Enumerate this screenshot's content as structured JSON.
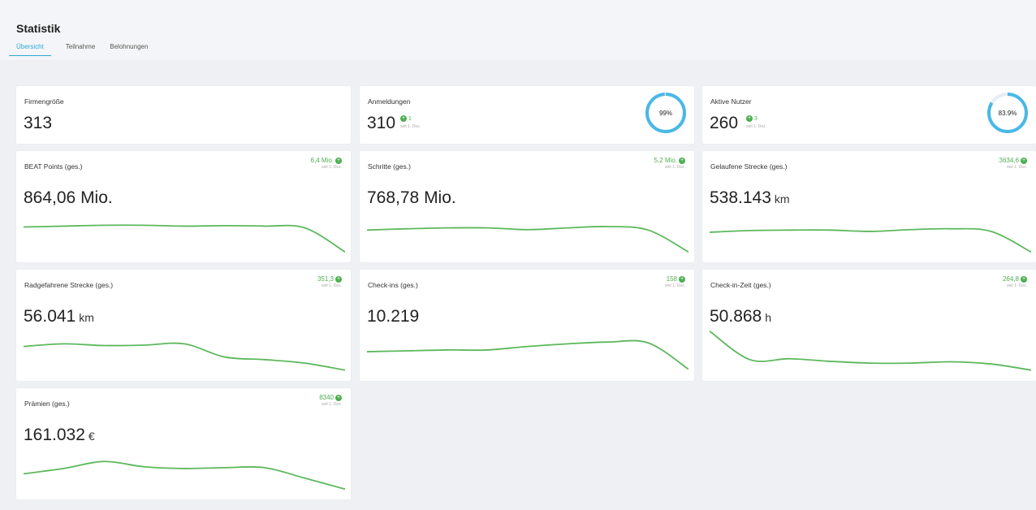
{
  "page": {
    "title": "Statistik",
    "tabs": [
      {
        "label": "Übersicht",
        "active": true
      },
      {
        "label": "Teilnahme",
        "active": false
      },
      {
        "label": "Belohnungen",
        "active": false
      }
    ]
  },
  "colors": {
    "accent": "#2aa8d8",
    "positive": "#4caf50",
    "sparkline": "#5cb85c",
    "ring": "#49b8e6"
  },
  "top_cards": {
    "firmengroesse": {
      "title": "Firmengröße",
      "value": "313"
    },
    "anmeldungen": {
      "title": "Anmeldungen",
      "value": "310",
      "delta": "1",
      "delta_since": "seit 1. Dez.",
      "ring_label": "99%",
      "ring_percent": 99
    },
    "aktive_nutzer": {
      "title": "Aktive Nutzer",
      "value": "260",
      "delta": "3",
      "delta_since": "seit 1. Dez.",
      "ring_label": "83.9%",
      "ring_percent": 83.9
    }
  },
  "metric_cards": [
    {
      "key": "beat",
      "title": "BEAT Points (ges.)",
      "value": "864,06 Mio.",
      "unit": "",
      "delta": "6,4 Mio.",
      "delta_since": "seit 1. Dez.",
      "trend": [
        0.62,
        0.64,
        0.66,
        0.66,
        0.64,
        0.65,
        0.64,
        0.6,
        0.05
      ]
    },
    {
      "key": "schritte",
      "title": "Schritte (ges.)",
      "value": "768,78 Mio.",
      "unit": "",
      "delta": "5,2 Mio.",
      "delta_since": "seit 1. Dez.",
      "trend": [
        0.55,
        0.58,
        0.6,
        0.6,
        0.56,
        0.6,
        0.63,
        0.55,
        0.05
      ]
    },
    {
      "key": "strecke",
      "title": "Gelaufene Strecke (ges.)",
      "value": "538.143",
      "unit": "km",
      "delta": "3634,6",
      "delta_since": "seit 1. Dez.",
      "trend": [
        0.5,
        0.54,
        0.55,
        0.55,
        0.52,
        0.56,
        0.58,
        0.52,
        0.05
      ]
    },
    {
      "key": "rad",
      "title": "Radgefahrene Strecke (ges.)",
      "value": "56.041",
      "unit": "km",
      "delta": "351,3",
      "delta_since": "seit 1. Dez.",
      "trend": [
        0.6,
        0.66,
        0.62,
        0.63,
        0.66,
        0.36,
        0.3,
        0.22,
        0.06
      ]
    },
    {
      "key": "checkins",
      "title": "Check-ins (ges.)",
      "value": "10.219",
      "unit": "",
      "delta": "158",
      "delta_since": "seit 1. Dez.",
      "trend": [
        0.48,
        0.5,
        0.52,
        0.52,
        0.6,
        0.66,
        0.7,
        0.68,
        0.08
      ]
    },
    {
      "key": "checkinzeit",
      "title": "Check-in-Zeit (ges.)",
      "value": "50.868",
      "unit": "h",
      "delta": "264,8",
      "delta_since": "seit 1. Dez.",
      "trend": [
        0.95,
        0.3,
        0.32,
        0.26,
        0.22,
        0.22,
        0.25,
        0.2,
        0.06
      ]
    },
    {
      "key": "praemien",
      "title": "Prämien (ges.)",
      "value": "161.032",
      "unit": "€",
      "delta": "8340",
      "delta_since": "seit 1. Dez.",
      "trend": [
        0.4,
        0.52,
        0.68,
        0.56,
        0.52,
        0.54,
        0.54,
        0.3,
        0.05
      ]
    }
  ]
}
